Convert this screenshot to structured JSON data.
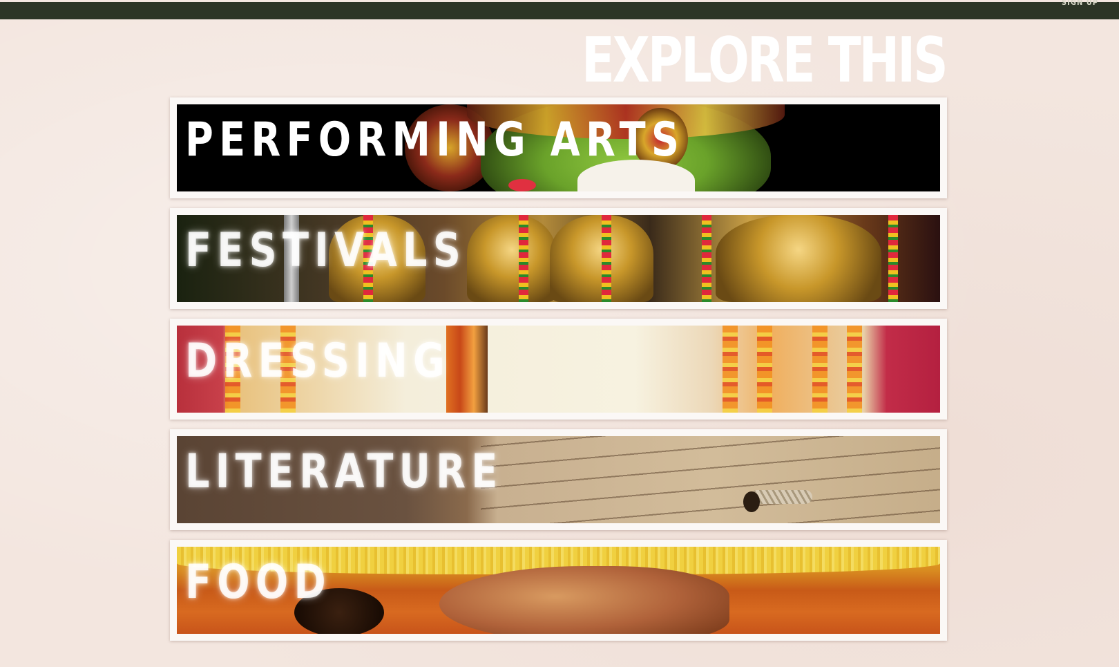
{
  "header": {
    "nav_link": "SIGN UP"
  },
  "title": "EXPLORE THIS",
  "categories": [
    {
      "label": "PERFORMING ARTS"
    },
    {
      "label": "FESTIVALS"
    },
    {
      "label": "DRESSING"
    },
    {
      "label": "LITERATURE"
    },
    {
      "label": "FOOD"
    }
  ],
  "colors": {
    "topbar": "#2c3526",
    "background": "#f3e6df",
    "card_frame": "#fbf8f6",
    "label_text": "#ffffff"
  }
}
